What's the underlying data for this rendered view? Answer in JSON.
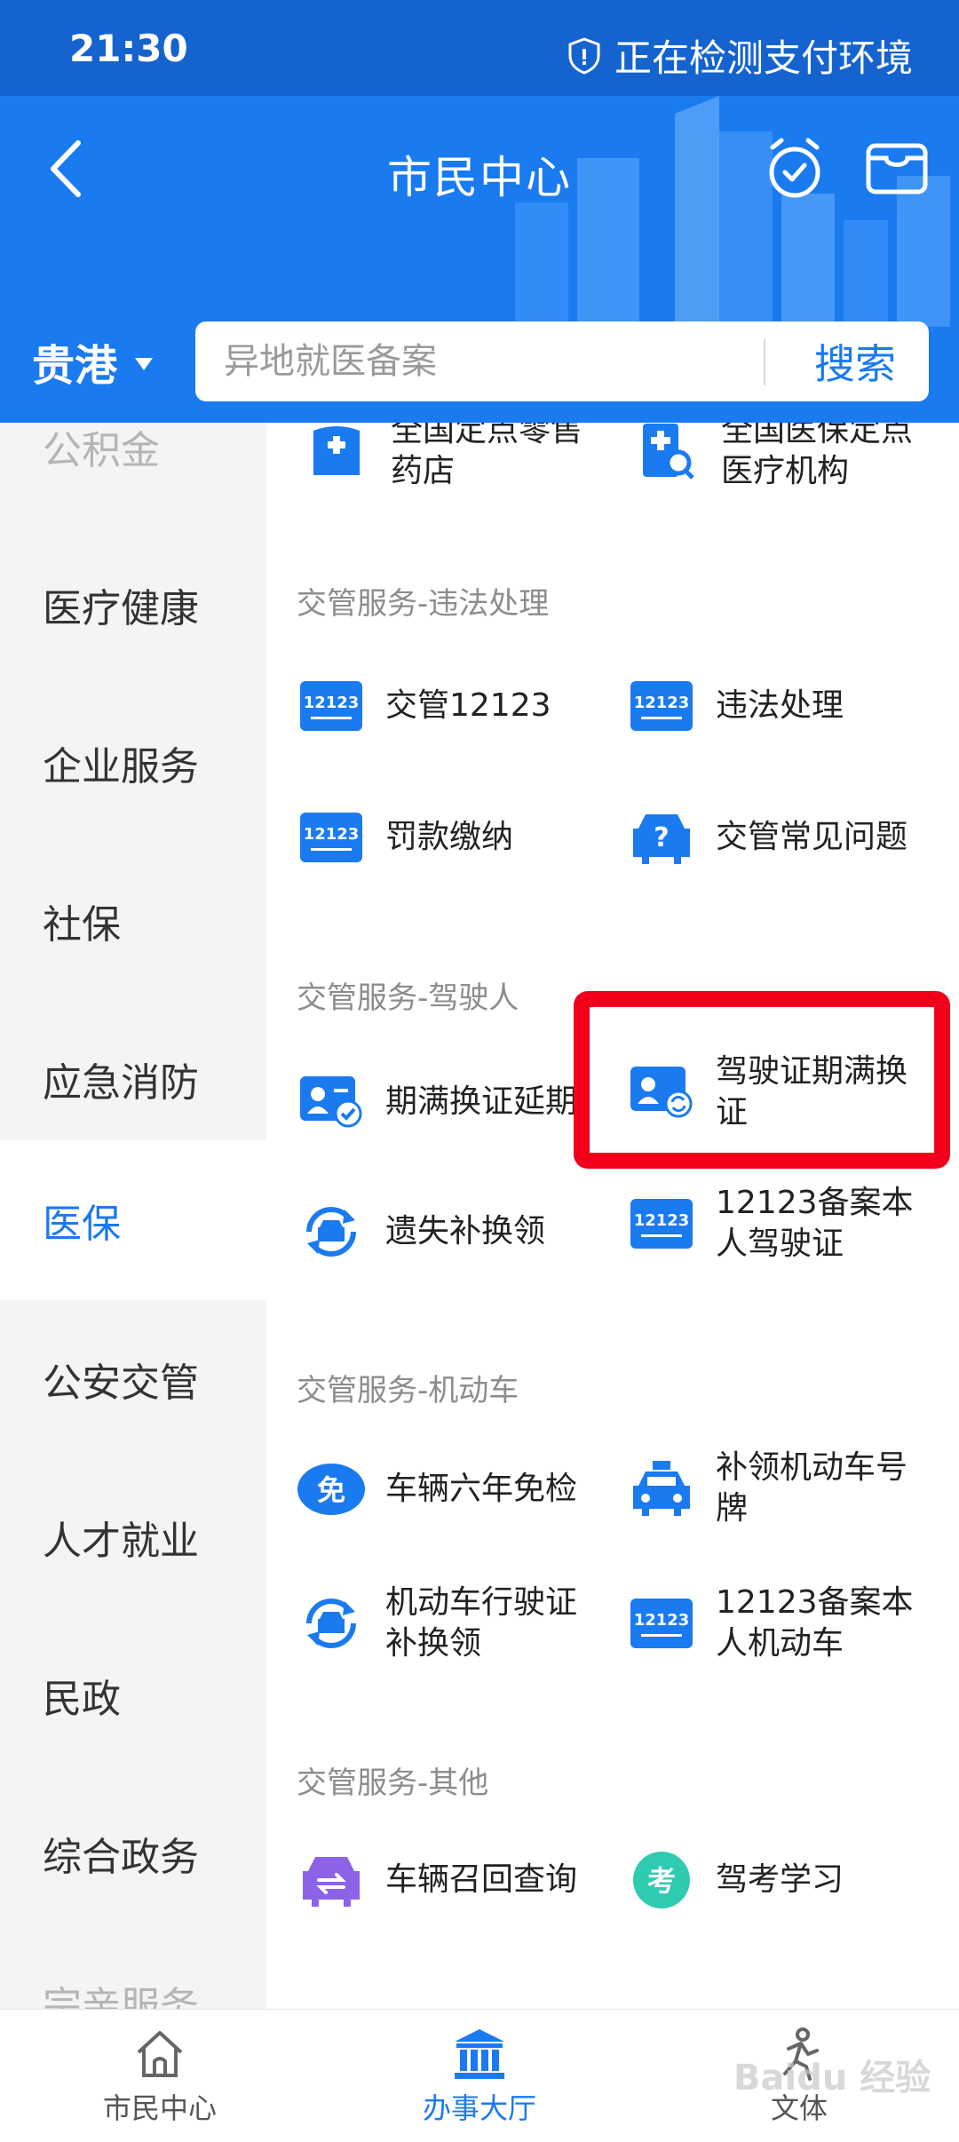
{
  "status_bar": {
    "time": "21:30",
    "security_text": "正在检测支付环境"
  },
  "header": {
    "title": "市民中心",
    "city": "贵港",
    "search": {
      "placeholder": "异地就医备案",
      "button_label": "搜索"
    },
    "icons": [
      "back-arrow-icon",
      "alarm-clock-icon",
      "wallet-icon",
      "shield-icon"
    ]
  },
  "sidebar": {
    "items": [
      {
        "label": "公积金"
      },
      {
        "label": "医疗健康"
      },
      {
        "label": "企业服务"
      },
      {
        "label": "社保"
      },
      {
        "label": "应急消防"
      },
      {
        "label": "医保"
      },
      {
        "label": "公安交管"
      },
      {
        "label": "人才就业"
      },
      {
        "label": "民政"
      },
      {
        "label": "综合政务"
      },
      {
        "label": "宗亲服务"
      }
    ],
    "active_label": "医保"
  },
  "content": {
    "partial_top": [
      {
        "label": "全国定点零售药店",
        "icon": "pharmacy-icon"
      },
      {
        "label": "全国医保定点医疗机构",
        "icon": "hospital-search-icon"
      }
    ],
    "sections": [
      {
        "title": "交管服务-违法处理",
        "items": [
          {
            "label": "交管12123",
            "icon": "traffic-12123-icon"
          },
          {
            "label": "违法处理",
            "icon": "traffic-12123-icon"
          },
          {
            "label": "罚款缴纳",
            "icon": "traffic-12123-icon"
          },
          {
            "label": "交管常见问题",
            "icon": "car-question-icon"
          }
        ]
      },
      {
        "title": "交管服务-驾驶人",
        "items": [
          {
            "label": "期满换证延期",
            "icon": "license-check-icon"
          },
          {
            "label": "驾驶证期满换证",
            "icon": "license-renew-icon"
          },
          {
            "label": "遗失补换领",
            "icon": "car-cycle-icon"
          },
          {
            "label": "12123备案本人驾驶证",
            "icon": "traffic-12123-icon"
          }
        ]
      },
      {
        "title": "交管服务-机动车",
        "items": [
          {
            "label": "车辆六年免检",
            "icon": "exempt-badge-icon"
          },
          {
            "label": "补领机动车号牌",
            "icon": "taxi-icon"
          },
          {
            "label": "机动车行驶证补换领",
            "icon": "car-cycle-icon"
          },
          {
            "label": "12123备案本人机动车",
            "icon": "traffic-12123-icon"
          }
        ]
      },
      {
        "title": "交管服务-其他",
        "items": [
          {
            "label": "车辆召回查询",
            "icon": "car-recall-icon"
          },
          {
            "label": "驾考学习",
            "icon": "exam-badge-icon"
          }
        ]
      }
    ],
    "badge_texts": {
      "traffic_12123": "12123",
      "exempt": "免",
      "exam": "考",
      "question": "?"
    }
  },
  "bottom_nav": {
    "items": [
      {
        "label": "市民中心",
        "icon": "home-icon"
      },
      {
        "label": "办事大厅",
        "icon": "government-building-icon"
      },
      {
        "label": "文体",
        "icon": "sports-figure-icon"
      }
    ],
    "active_label": "办事大厅"
  },
  "watermark": "Baidu 经验",
  "colors": {
    "brand_blue": "#1a7af0",
    "status_bar_blue": "#1463cf",
    "highlight_red": "#f2001b",
    "exam_green": "#2ecbb0",
    "recall_purple": "#8c63e8"
  }
}
